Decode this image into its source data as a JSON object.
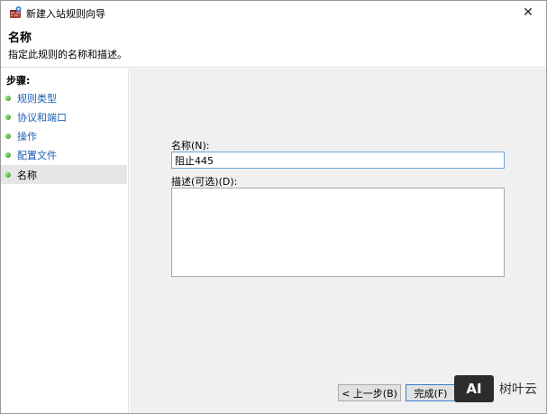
{
  "window": {
    "title": "新建入站规则向导",
    "close": "✕"
  },
  "header": {
    "title": "名称",
    "description": "指定此规则的名称和描述。"
  },
  "steps": {
    "label": "步骤:",
    "items": [
      {
        "label": "规则类型",
        "current": false
      },
      {
        "label": "协议和端口",
        "current": false
      },
      {
        "label": "操作",
        "current": false
      },
      {
        "label": "配置文件",
        "current": false
      },
      {
        "label": "名称",
        "current": true
      }
    ]
  },
  "form": {
    "name_label": "名称(N):",
    "name_value": "阻止445",
    "desc_label": "描述(可选)(D):",
    "desc_value": ""
  },
  "buttons": {
    "back": "< 上一步(B)",
    "finish": "完成(F)"
  },
  "watermark": {
    "logo": "AI",
    "text": "树叶云"
  },
  "colors": {
    "step_link": "#1a5fb4",
    "step_dot": "#2e9b1d",
    "content_bg": "#f0f0f0"
  },
  "icons": {
    "title": "firewall-wizard-icon",
    "close": "close-icon",
    "step": "green-dot-icon"
  }
}
